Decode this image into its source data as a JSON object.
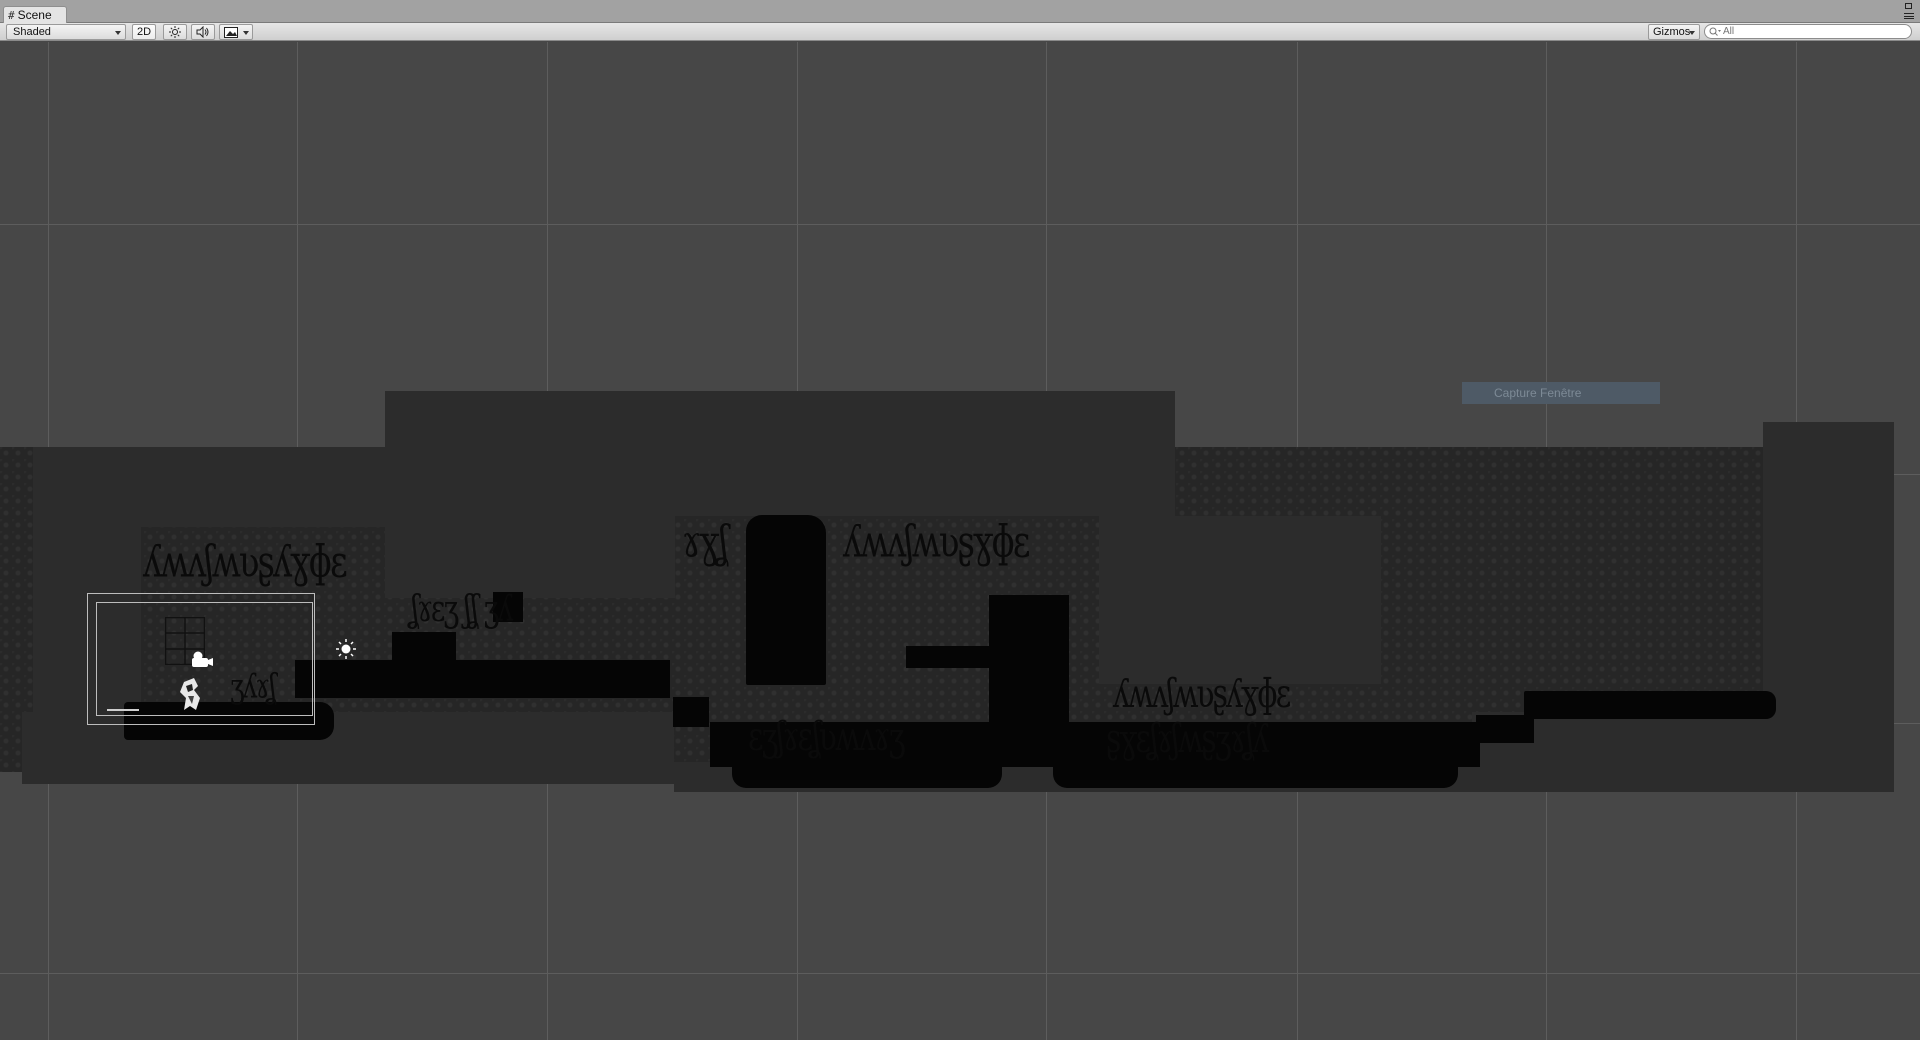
{
  "tab": {
    "icon": "hash-icon",
    "label": "Scene"
  },
  "toolbar": {
    "shading_mode": "Shaded",
    "toggle_2d": "2D",
    "lighting_icon": "sun-icon",
    "audio_icon": "speaker-icon",
    "effects_icon": "image-icon",
    "gizmos_label": "Gizmos",
    "search_placeholder": "All"
  },
  "viewport": {
    "overlay_label": "Capture Fenêtre",
    "light_icon": "light-gizmo-icon",
    "camera_icon": "camera-gizmo-icon",
    "character_icon": "player-sprite-icon"
  }
}
